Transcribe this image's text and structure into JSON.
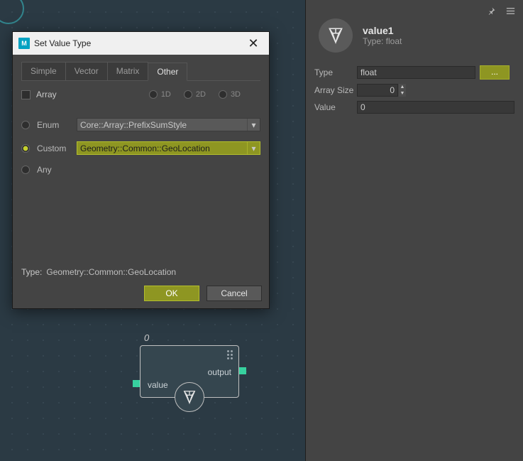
{
  "side": {
    "title": "value1",
    "subtitle": "Type: float",
    "type_label": "Type",
    "type_value": "float",
    "ellipsis": "...",
    "arr_label": "Array Size",
    "arr_value": "0",
    "val_label": "Value",
    "val_value": "0"
  },
  "dialog": {
    "title": "Set Value Type",
    "tabs": {
      "simple": "Simple",
      "vector": "Vector",
      "matrix": "Matrix",
      "other": "Other"
    },
    "array_label": "Array",
    "dims": {
      "d1": "1D",
      "d2": "2D",
      "d3": "3D"
    },
    "enum_label": "Enum",
    "enum_value": "Core::Array::PrefixSumStyle",
    "custom_label": "Custom",
    "custom_value": "Geometry::Common::GeoLocation",
    "any_label": "Any",
    "type_label": "Type:",
    "type_value": "Geometry::Common::GeoLocation",
    "ok": "OK",
    "cancel": "Cancel"
  },
  "node": {
    "header": "0",
    "output": "output",
    "value": "value"
  }
}
